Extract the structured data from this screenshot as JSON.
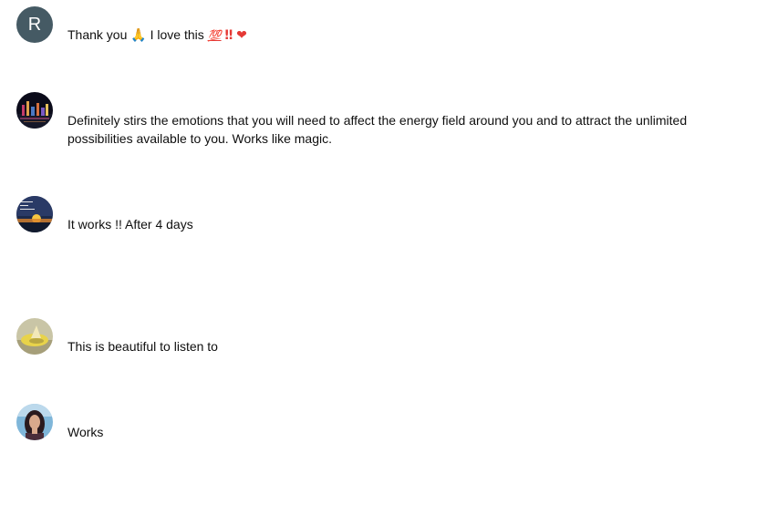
{
  "comments": [
    {
      "avatar": {
        "type": "letter",
        "letter": "R",
        "color": "#455a64"
      },
      "text_main": "Thank you ",
      "emojis": {
        "hands": "🙏",
        "love": " I love this ",
        "hundred": "💯",
        "bang": "‼",
        "heart": "❤"
      }
    },
    {
      "avatar": {
        "type": "image",
        "icon": "night-city-avatar"
      },
      "text": "Definitely stirs the emotions that you will need to affect the energy field around you and to attract the unlimited possibilities available to you. Works like magic."
    },
    {
      "avatar": {
        "type": "image",
        "icon": "sunset-avatar"
      },
      "text": "It works !! After 4 days"
    },
    {
      "avatar": {
        "type": "image",
        "icon": "yellow-object-avatar"
      },
      "text": "This is beautiful to listen to"
    },
    {
      "avatar": {
        "type": "image",
        "icon": "portrait-avatar"
      },
      "text": "Works"
    }
  ]
}
